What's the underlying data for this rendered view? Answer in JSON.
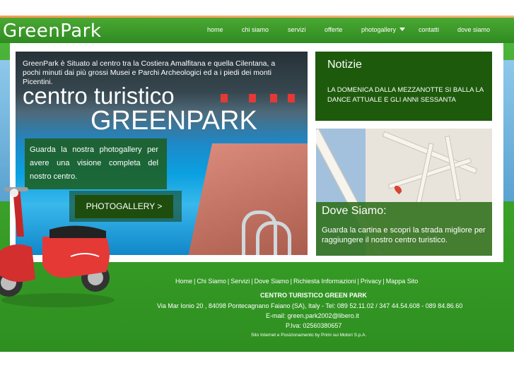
{
  "header": {
    "logo": "GreenPark",
    "nav": [
      {
        "label": "home"
      },
      {
        "label": "chi siamo"
      },
      {
        "label": "servizi"
      },
      {
        "label": "offerte"
      },
      {
        "label": "photogallery"
      },
      {
        "label": "contatti"
      },
      {
        "label": "dove siamo"
      }
    ]
  },
  "hero": {
    "intro": "GreenPark è Situato al centro tra la Costiera Amalfitana e quella Cilentana, a pochi minuti dai più grossi Musei e Parchi Archeologici ed a i piedi dei monti Picentini.",
    "title_line1": "centro turistico",
    "title_line2": "GREENPARK",
    "callout": "Guarda la nostra photogallery per avere una visione completa del nostro centro.",
    "button": "PHOTOGALLERY >"
  },
  "notizie": {
    "title": "Notizie",
    "text": "LA DOMENICA DALLA MEZZANOTTE SI BALLA LA DANCE ATTUALE E GLI ANNI SESSANTA"
  },
  "dove_siamo": {
    "title": "Dove Siamo:",
    "text": "Guarda la cartina e scopri la strada migliore per raggiungere il nostro centro turistico."
  },
  "footer": {
    "links": [
      "Home",
      "Chi Siamo",
      "Servizi",
      "Dove Siamo",
      "Richiesta Informazioni",
      "Privacy",
      "Mappa Sito"
    ],
    "separator": "|",
    "company": "CENTRO TURISTICO GREEN PARK",
    "address": "Via Mar Ionio 20 , 84098 Pontecagnano Faiano (SA), Italy - Tel: 089 52.11.02 / 347 44.54.608 - 089 84.86.60",
    "email": "E-mail: green.park2002@libero.it",
    "piva": "P.Iva: 02560380657",
    "credits": "Sito Internet e Posizionamento by Primi sui Motori S.p.A."
  },
  "colors": {
    "header_green": "#3a9a28",
    "panel_dark_green": "#1e5a0c",
    "accent_orange": "#ff9a56",
    "scooter_red": "#e53935"
  }
}
